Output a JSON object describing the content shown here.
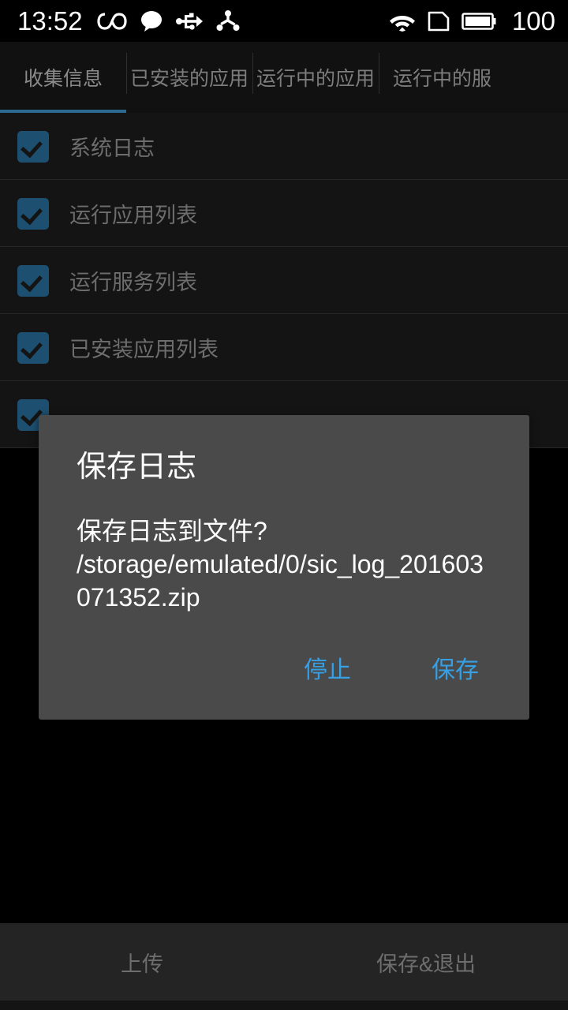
{
  "status_bar": {
    "time": "13:52",
    "battery_level": "100",
    "icons_left": [
      "infinity-icon",
      "message-bubble-icon",
      "usb-icon",
      "nfc-share-icon"
    ],
    "icons_right": [
      "wifi-icon",
      "sdcard-icon",
      "battery-full-icon"
    ],
    "background_color": "#000000",
    "text_color": "#ffffff"
  },
  "tabs": {
    "active_index": 0,
    "indicator_color": "#2d6a92",
    "items": [
      {
        "label": "收集信息"
      },
      {
        "label": "已安装的应用"
      },
      {
        "label": "运行中的应用"
      },
      {
        "label": "运行中的服"
      }
    ]
  },
  "list": {
    "rows": [
      {
        "label": "系统日志",
        "checked": true
      },
      {
        "label": "运行应用列表",
        "checked": true
      },
      {
        "label": "运行服务列表",
        "checked": true
      },
      {
        "label": "已安装应用列表",
        "checked": true
      },
      {
        "label": "",
        "checked": true
      }
    ],
    "checkbox_color": "#1d5070",
    "label_color": "#6d6d6d"
  },
  "dialog": {
    "title": "保存日志",
    "message": "保存日志到文件? /storage/emulated/0/sic_log_201603071352.zip",
    "background_color": "#4a4a4a",
    "button_color": "#37a0e4",
    "buttons": {
      "negative": "停止",
      "positive": "保存"
    }
  },
  "bottom_bar": {
    "upload_label": "上传",
    "save_exit_label": "保存&退出",
    "background_color": "#242424",
    "text_color": "#6e6e6e"
  }
}
